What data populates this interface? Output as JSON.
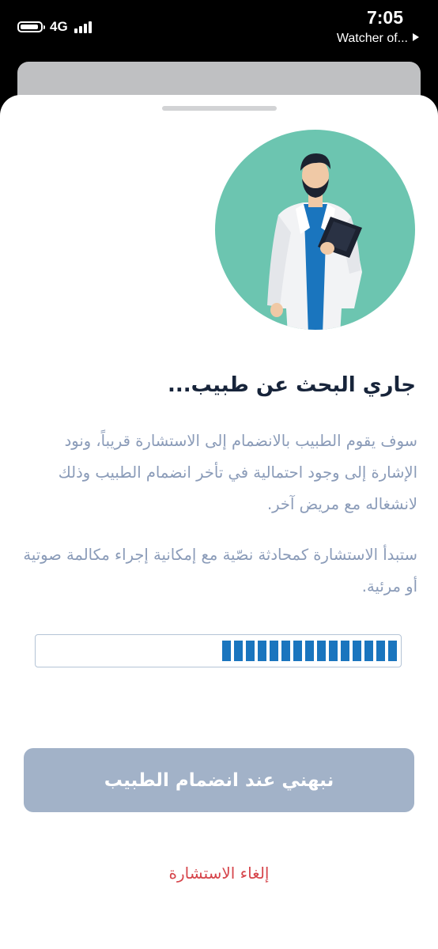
{
  "status_bar": {
    "network": "4G",
    "time": "7:05",
    "now_playing": "Watcher of..."
  },
  "screen": {
    "title": "جاري البحث عن طبيب...",
    "paragraph_1": "سوف يقوم الطبيب بالانضمام إلى الاستشارة قريباً، ونود الإشارة إلى وجود احتمالية في تأخر انضمام الطبيب وذلك لانشغاله مع مريض آخر.",
    "paragraph_2": "ستبدأ الاستشارة كمحادثة نصّية مع إمكانية إجراء مكالمة صوتية أو مرئية.",
    "progress": {
      "filled_segments": 15,
      "color": "#1a75be"
    },
    "notify_button_label": "نبهني عند انضمام الطبيب",
    "cancel_label": "إلغاء الاستشارة"
  },
  "colors": {
    "illustration_circle": "#6cc5b0",
    "button_disabled": "#a2b2c8",
    "cancel_red": "#d6454b",
    "title_dark": "#17243a",
    "body_text": "#8a9bb8"
  },
  "icons": {
    "battery": "battery-icon",
    "signal": "signal-bars-icon",
    "play": "play-icon",
    "doctor": "doctor-illustration"
  }
}
